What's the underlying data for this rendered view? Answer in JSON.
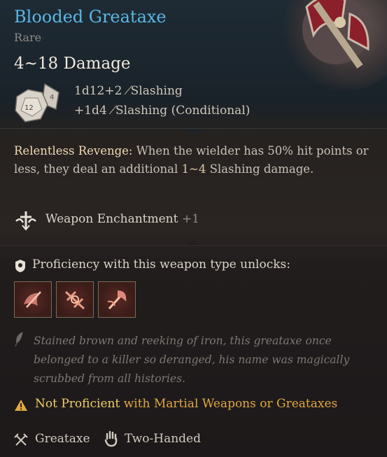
{
  "item": {
    "name": "Blooded Greataxe",
    "rarity": "Rare",
    "damage_total": "4~18 Damage",
    "damage_lines": [
      {
        "dice": "1d12+2",
        "type": "Slashing"
      },
      {
        "dice": "+1d4",
        "type": "Slashing (Conditional)"
      }
    ],
    "die_face": "12"
  },
  "passive": {
    "name": "Relentless Revenge:",
    "text_before": " When the wielder has 50% hit points or less, they deal an additional ",
    "dice": "1~4",
    "text_after": " Slashing damage."
  },
  "enchantment": {
    "label": "Weapon Enchantment",
    "bonus": "+1"
  },
  "proficiency": {
    "label": "Proficiency with this weapon type unlocks:",
    "actions": [
      "action-icon-1",
      "action-icon-2",
      "action-icon-3"
    ]
  },
  "flavor": "Stained brown and reeking of iron, this greataxe once belonged to a killer so deranged, his name was magically scrubbed from all histories.",
  "warning": {
    "lead": "Not Proficient",
    "rest": " with Martial Weapons or Greataxes"
  },
  "footer": {
    "type": "Greataxe",
    "handed": "Two-Handed"
  },
  "colors": {
    "title": "#5ab7e6",
    "warning": "#e0a942",
    "action_border": "#7d6a55"
  }
}
